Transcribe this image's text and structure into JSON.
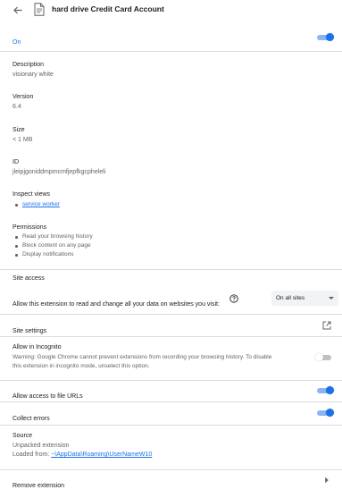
{
  "header": {
    "back_icon": "arrow-left-icon",
    "doc_icon": "document-icon",
    "title": "hard drive Credit Card Account"
  },
  "on_row": {
    "label": "On",
    "toggle_on": true
  },
  "description": {
    "label": "Description",
    "value": "visionary white"
  },
  "version": {
    "label": "Version",
    "value": "6.4"
  },
  "size": {
    "label": "Size",
    "value": "< 1 MB"
  },
  "id": {
    "label": "ID",
    "value": "jleipjgoniddmpmcmfjepfkgcpheleli"
  },
  "inspect_views": {
    "label": "Inspect views",
    "link": "service worker"
  },
  "permissions": {
    "label": "Permissions",
    "items": [
      "Read your browsing history",
      "Block content on any page",
      "Display notifications"
    ]
  },
  "site_access": {
    "label": "Site access",
    "text": "Allow this extension to read and change all your data on websites you visit:",
    "help_icon": "help-circle-icon",
    "select_value": "On all sites"
  },
  "site_settings": {
    "label": "Site settings",
    "icon": "open-in-new-icon"
  },
  "incognito": {
    "label": "Allow in Incognito",
    "warning_line1": "Warning: Google Chrome cannot prevent extensions from recording your browsing history. To disable",
    "warning_line2": "this extension in incognito mode, unselect this option.",
    "toggle_on": false
  },
  "file_urls": {
    "label": "Allow access to file URLs",
    "toggle_on": true
  },
  "collect_errors": {
    "label": "Collect errors",
    "toggle_on": true
  },
  "source": {
    "label": "Source",
    "type": "Unpacked extension",
    "loaded_from_label": "Loaded from: ",
    "loaded_from_path": "~\\AppData\\Roaming\\UserNameW10"
  },
  "remove": {
    "label": "Remove extension",
    "icon": "chevron-right-icon"
  },
  "colors": {
    "accent": "#1a73e8",
    "text": "#202124",
    "secondary": "#5f6368",
    "divider": "#dadce0"
  }
}
